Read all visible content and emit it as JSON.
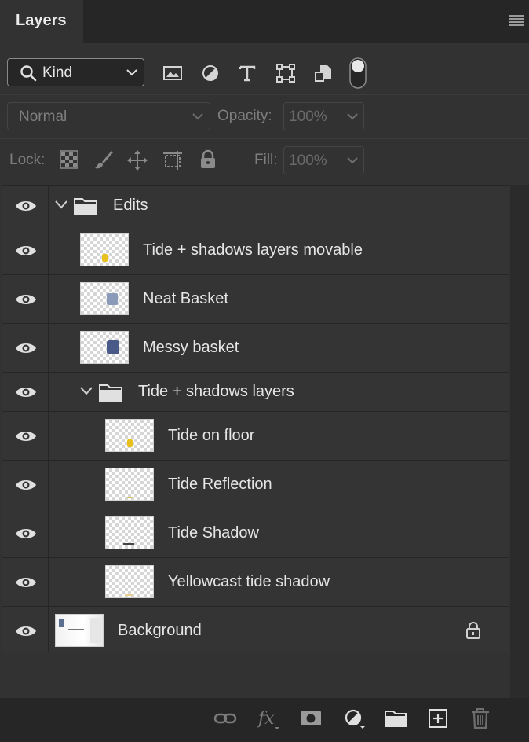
{
  "panel": {
    "tab_title": "Layers",
    "menu_icon": "hamburger-menu-icon"
  },
  "filter": {
    "kind_label": "Kind",
    "filter_icons": [
      "image-filter-icon",
      "adjustment-filter-icon",
      "type-filter-icon",
      "shape-filter-icon",
      "smart-object-filter-icon",
      "filter-toggle-icon"
    ]
  },
  "blend": {
    "mode": "Normal",
    "opacity_label": "Opacity:",
    "opacity_value": "100%"
  },
  "lock": {
    "label": "Lock:",
    "fill_label": "Fill:",
    "fill_value": "100%",
    "icons": [
      "lock-transparency-icon",
      "lock-paint-icon",
      "lock-position-icon",
      "lock-artboard-icon",
      "lock-all-icon"
    ]
  },
  "layers": [
    {
      "name": "Edits",
      "type": "group",
      "expanded": true
    },
    {
      "name": "Tide + shadows layers movable",
      "type": "layer"
    },
    {
      "name": "Neat Basket",
      "type": "layer"
    },
    {
      "name": "Messy basket",
      "type": "layer"
    },
    {
      "name": "Tide + shadows layers",
      "type": "group",
      "expanded": true
    },
    {
      "name": "Tide on floor",
      "type": "layer"
    },
    {
      "name": "Tide Reflection",
      "type": "layer"
    },
    {
      "name": "Tide Shadow",
      "type": "layer"
    },
    {
      "name": "Yellowcast tide shadow",
      "type": "layer"
    },
    {
      "name": "Background",
      "type": "layer",
      "locked": true
    }
  ],
  "bottom_actions": [
    "link-layers-icon",
    "fx-icon",
    "add-mask-icon",
    "new-adjustment-icon",
    "new-group-icon",
    "new-layer-icon",
    "delete-layer-icon"
  ],
  "colors": {
    "panel_bg": "#323232",
    "dark_bg": "#262626",
    "row_bg": "#343434",
    "text": "#e6e6e6"
  }
}
